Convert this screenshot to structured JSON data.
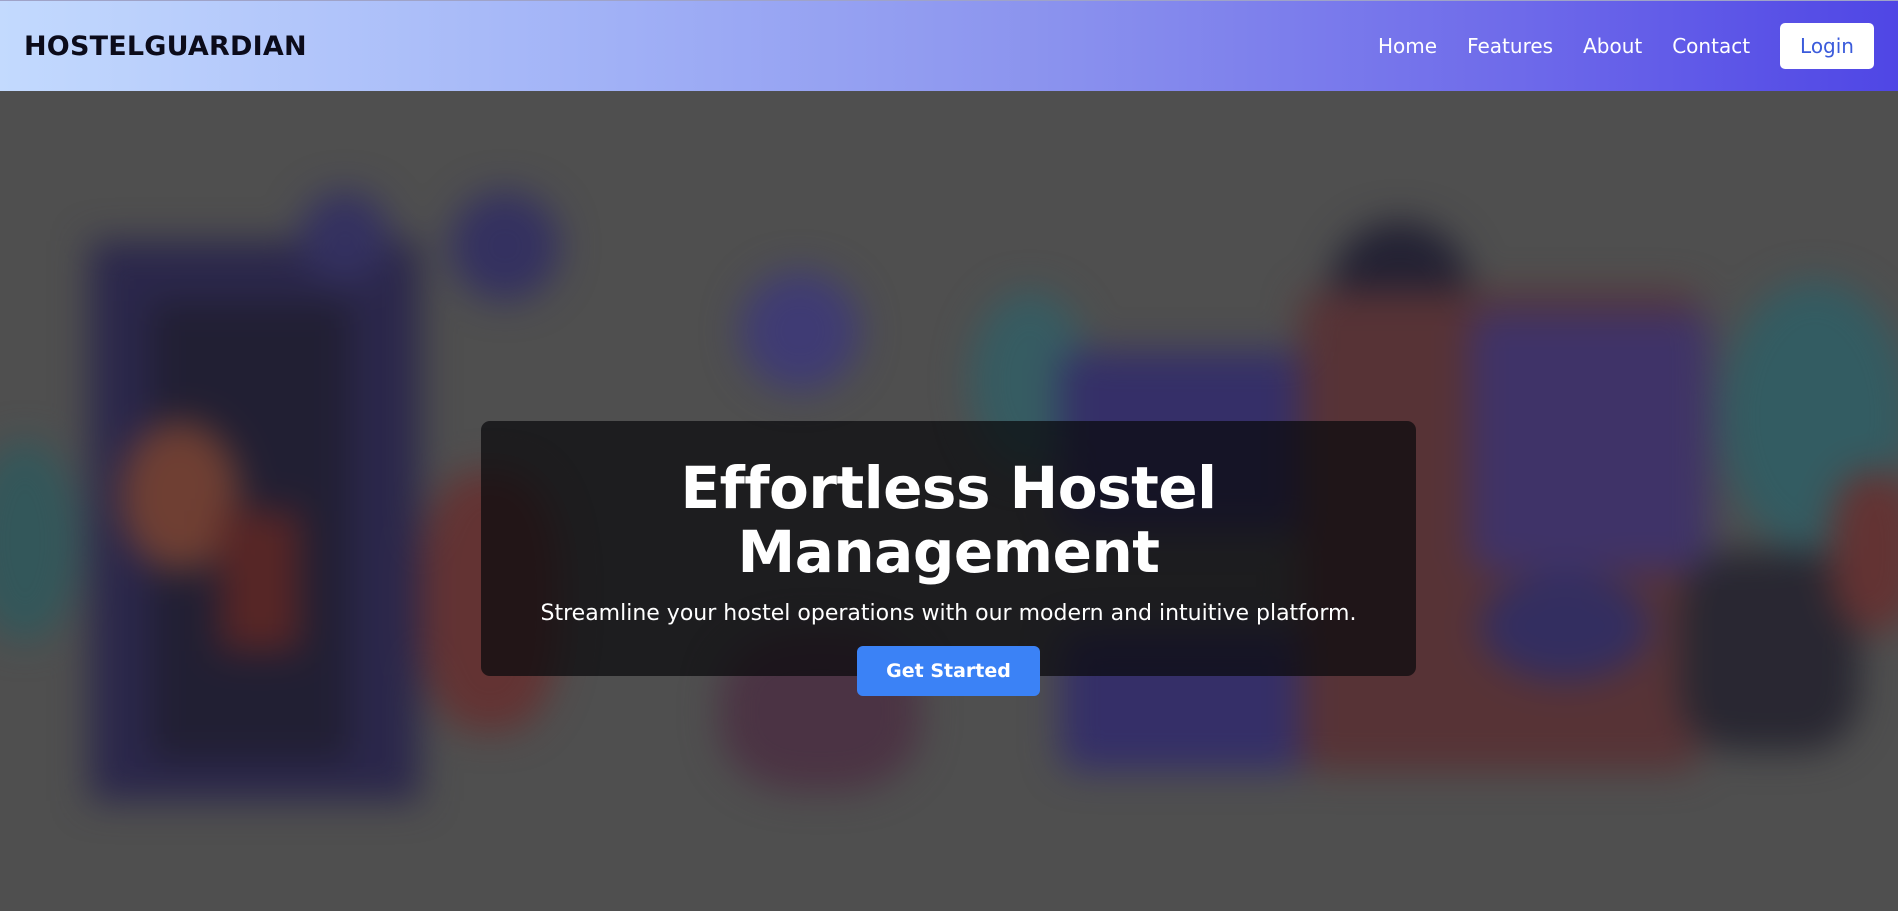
{
  "brand": {
    "name": "HOSTELGUARDIAN"
  },
  "nav": {
    "links": [
      "Home",
      "Features",
      "About",
      "Contact"
    ],
    "login_label": "Login"
  },
  "hero": {
    "title": "Effortless Hostel Management",
    "subtitle": "Streamline your hostel operations with our modern and intuitive platform.",
    "cta_label": "Get Started"
  },
  "colors": {
    "nav_gradient_start": "#c3dafe",
    "nav_gradient_end": "#4f46e5",
    "cta": "#3b82f6",
    "login_text": "#3b5bdb",
    "page_background": "#4f4f4f"
  }
}
